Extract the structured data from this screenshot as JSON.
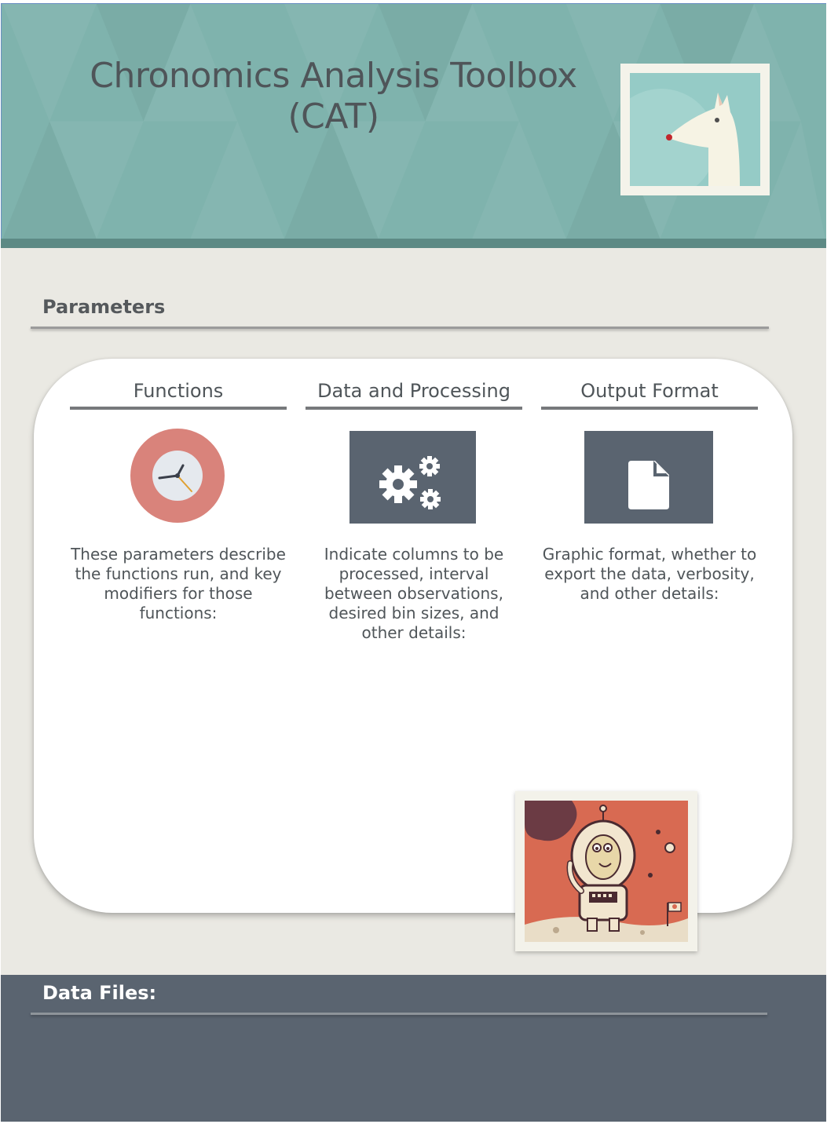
{
  "header": {
    "title_line1": "Chronomics Analysis Toolbox",
    "title_line2": "(CAT)",
    "logo_icon": "fox-logo-icon"
  },
  "parameters": {
    "section_title": "Parameters",
    "columns": [
      {
        "heading": "Functions",
        "icon": "clock-icon",
        "description": "These parameters describe the functions run, and key modifiers for those functions:"
      },
      {
        "heading": "Data and Processing",
        "icon": "gears-icon",
        "description": "Indicate columns to be processed, interval between observations, desired bin sizes, and other details:"
      },
      {
        "heading": "Output Format",
        "icon": "document-icon",
        "description": "Graphic format, whether to export the data, verbosity, and other details:"
      }
    ],
    "illustration": "astronaut-illustration"
  },
  "data_files": {
    "section_title": "Data Files:"
  },
  "colors": {
    "header_bg": "#7fb3ad",
    "header_band": "#5d8a85",
    "page_bg": "#eae9e3",
    "card_bg": "#ffffff",
    "data_band": "#5a6470",
    "clock_ring": "#d9837b",
    "icon_tile": "#5a6470"
  }
}
